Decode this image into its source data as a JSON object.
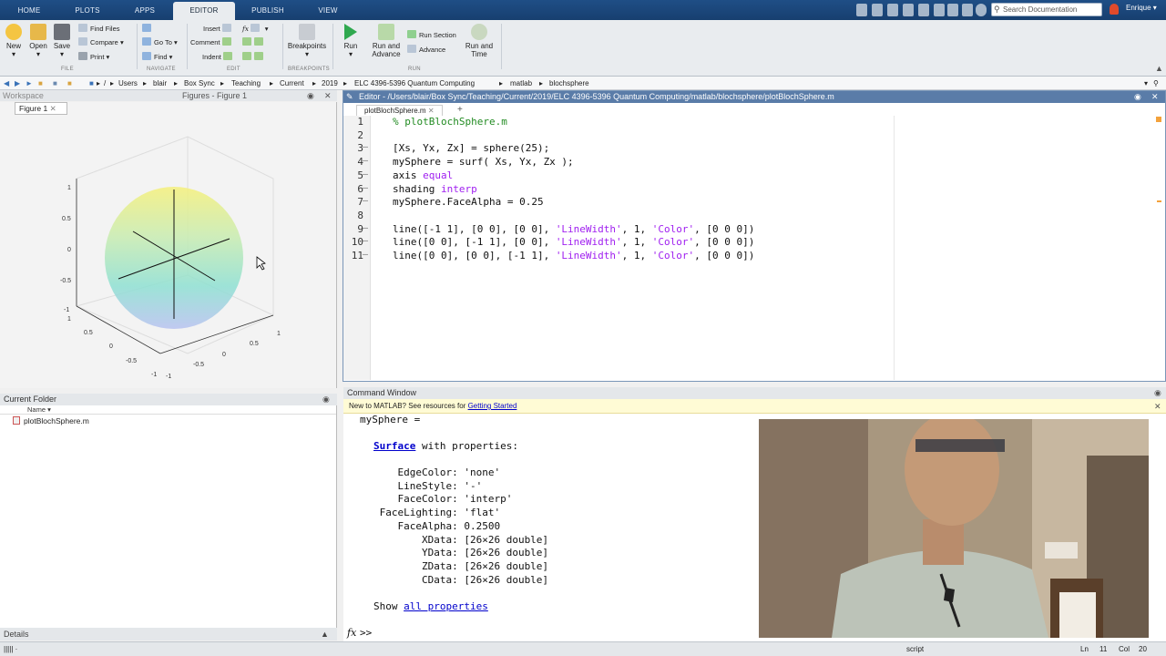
{
  "tabs": [
    "HOME",
    "PLOTS",
    "APPS",
    "EDITOR",
    "PUBLISH",
    "VIEW"
  ],
  "search": {
    "placeholder": "Search Documentation"
  },
  "user": "Enrique",
  "ribbon": {
    "new": "New",
    "open": "Open",
    "save": "Save",
    "find_files": "Find Files",
    "compare": "Compare",
    "print": "Print",
    "insert": "Insert",
    "comment": "Comment",
    "indent": "Indent",
    "fx": "fx",
    "goto": "Go To",
    "find": "Find",
    "breakpoints": "Breakpoints",
    "run": "Run",
    "run_advance_1": "Run and",
    "run_advance_2": "Advance",
    "run_section": "Run Section",
    "advance": "Advance",
    "run_time_1": "Run and",
    "run_time_2": "Time",
    "groups": {
      "file": "FILE",
      "navigate": "NAVIGATE",
      "edit": "EDIT",
      "breakpoints": "BREAKPOINTS",
      "run": "RUN"
    }
  },
  "path": [
    "/",
    "Users",
    "blair",
    "Box Sync",
    "Teaching",
    "Current",
    "2019",
    "ELC 4396-5396 Quantum Computing",
    "matlab",
    "blochsphere"
  ],
  "workspace_title": "Workspace",
  "figures_title": "Figures - Figure 1",
  "figure_tab": "Figure 1",
  "axes": {
    "z": [
      "1",
      "0.5",
      "0",
      "-0.5",
      "-1"
    ],
    "x": [
      "1",
      "0.5",
      "0",
      "-0.5",
      "-1"
    ],
    "y": [
      "-1",
      "-0.5",
      "0",
      "0.5",
      "1"
    ]
  },
  "editor": {
    "title": "Editor - /Users/blair/Box Sync/Teaching/Current/2019/ELC 4396-5396 Quantum Computing/matlab/blochsphere/plotBlochSphere.m",
    "tab": "plotBlochSphere.m",
    "line_numbers": [
      "1",
      "2",
      "3",
      "4",
      "5",
      "6",
      "7",
      "8",
      "9",
      "10",
      "11"
    ],
    "lines": [
      {
        "parts": [
          [
            "cm",
            "% plotBlochSphere.m"
          ]
        ]
      },
      {
        "parts": []
      },
      {
        "parts": [
          [
            "",
            "[Xs, Yx, Zx] = sphere(25);"
          ]
        ]
      },
      {
        "parts": [
          [
            "",
            "mySphere = surf( Xs, Yx, Zx );"
          ]
        ]
      },
      {
        "parts": [
          [
            "",
            "axis "
          ],
          [
            "kw",
            "equal"
          ]
        ]
      },
      {
        "parts": [
          [
            "",
            "shading "
          ],
          [
            "kw",
            "interp"
          ]
        ]
      },
      {
        "parts": [
          [
            "",
            "mySphere.FaceAlpha = 0.25"
          ]
        ]
      },
      {
        "parts": []
      },
      {
        "parts": [
          [
            "",
            "line([-1 1], [0 0], [0 0], "
          ],
          [
            "str",
            "'LineWidth'"
          ],
          [
            "",
            ", 1, "
          ],
          [
            "str",
            "'Color'"
          ],
          [
            "",
            ", [0 0 0])"
          ]
        ]
      },
      {
        "parts": [
          [
            "",
            "line([0 0], [-1 1], [0 0], "
          ],
          [
            "str",
            "'LineWidth'"
          ],
          [
            "",
            ", 1, "
          ],
          [
            "str",
            "'Color'"
          ],
          [
            "",
            ", [0 0 0])"
          ]
        ]
      },
      {
        "parts": [
          [
            "",
            "line([0 0], [0 0], [-1 1], "
          ],
          [
            "str",
            "'LineWidth'"
          ],
          [
            "",
            ", 1, "
          ],
          [
            "str",
            "'Color'"
          ],
          [
            "",
            ", [0 0 0])"
          ]
        ]
      }
    ],
    "dashed_lines": [
      3,
      4,
      5,
      6,
      7,
      9,
      10,
      11
    ]
  },
  "current_folder": {
    "title": "Current Folder",
    "col_name": "Name",
    "files": [
      "plotBlochSphere.m"
    ]
  },
  "details": "Details",
  "command": {
    "title": "Command Window",
    "banner": "New to MATLAB? See resources for ",
    "banner_link": "Getting Started",
    "var": "mySphere =",
    "surface": "Surface",
    "with_props": " with properties:",
    "props": [
      "    EdgeColor: 'none'",
      "    LineStyle: '-'",
      "    FaceColor: 'interp'",
      " FaceLighting: 'flat'",
      "    FaceAlpha: 0.2500",
      "        XData: [26×26 double]",
      "        YData: [26×26 double]",
      "        ZData: [26×26 double]",
      "        CData: [26×26 double]"
    ],
    "show": "Show ",
    "all_props": "all properties",
    "prompt": ">>"
  },
  "status": {
    "left": "||||| ·",
    "mode": "script",
    "ln": "Ln",
    "ln_val": "11",
    "col": "Col",
    "col_val": "20"
  }
}
